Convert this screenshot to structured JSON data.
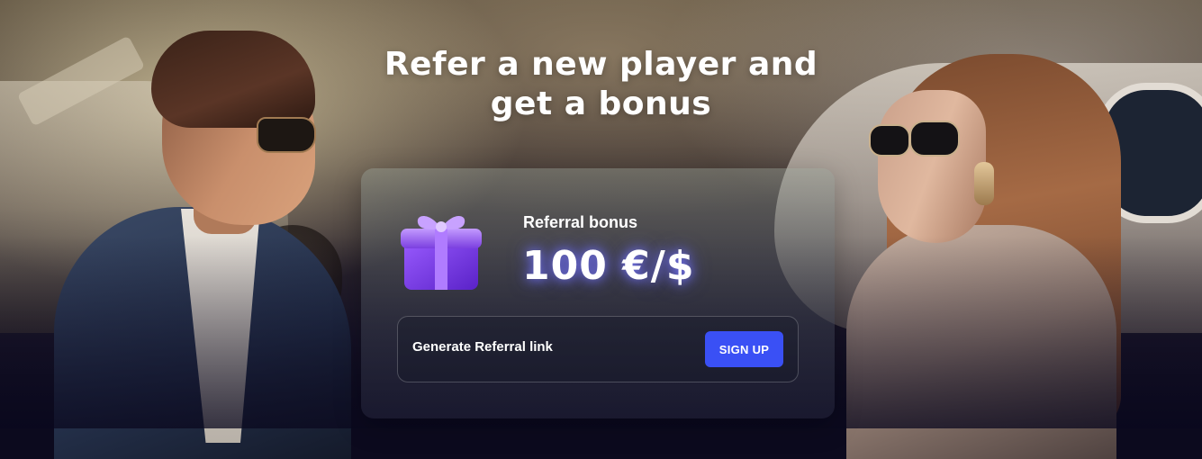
{
  "hero": {
    "title_line1": "Refer a new player and",
    "title_line2": "get a bonus"
  },
  "card": {
    "icon": "gift-box-icon",
    "bonus_label": "Referral bonus",
    "bonus_value": "100 €/$",
    "link_label": "Generate Referral link",
    "signup_label": "SIGN UP"
  },
  "colors": {
    "button": "#3a50f5",
    "gift_primary": "#7b3fe0",
    "gift_ribbon": "#b07cff"
  }
}
